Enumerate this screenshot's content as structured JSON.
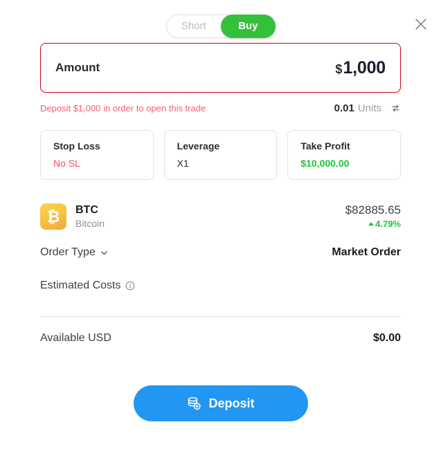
{
  "toggle": {
    "short_label": "Short",
    "buy_label": "Buy",
    "active": "Buy",
    "active_color": "#33c13c"
  },
  "close": {
    "icon": "close-icon"
  },
  "amount": {
    "label": "Amount",
    "currency_symbol": "$",
    "value": "1,000",
    "border_color": "#d0021b",
    "error_text": "Deposit $1,000 in order to open this trade",
    "error_color": "#f4606c",
    "units_value": "0.01",
    "units_label": "Units",
    "swap_icon": "swap-icon"
  },
  "cards": [
    {
      "title": "Stop Loss",
      "value": "No SL",
      "value_color": "#fa4d56"
    },
    {
      "title": "Leverage",
      "value": "X1",
      "value_color": "#2b2b2b"
    },
    {
      "title": "Take Profit",
      "value": "$10,000.00",
      "value_color": "#17c636"
    }
  ],
  "asset": {
    "logo_glyph": "₿",
    "symbol": "BTC",
    "name": "Bitcoin",
    "price": "$82885.65",
    "change": "4.79%",
    "change_color": "#22c03a",
    "change_direction": "up"
  },
  "order_type": {
    "label": "Order Type",
    "chevron_icon": "chevron-down-icon",
    "value": "Market Order"
  },
  "estimated_costs": {
    "label": "Estimated Costs",
    "info_icon": "info-icon",
    "value": ""
  },
  "available": {
    "label": "Available USD",
    "value": "$0.00"
  },
  "deposit": {
    "label": "Deposit",
    "icon": "deposit-coins-icon",
    "color": "#2196f3"
  }
}
